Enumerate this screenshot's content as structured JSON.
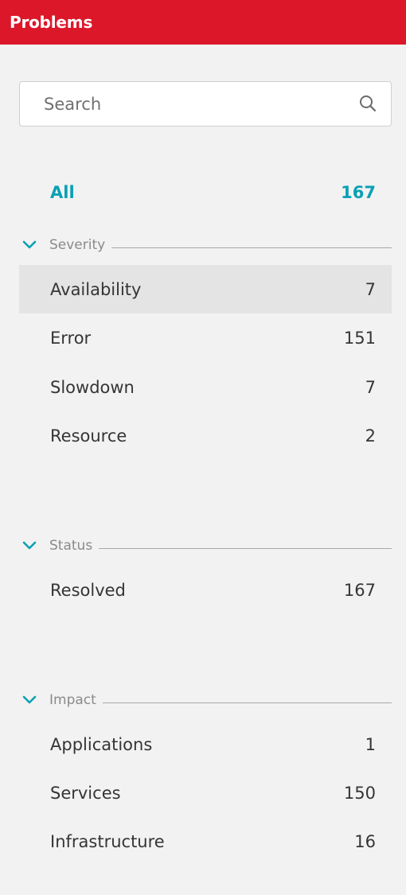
{
  "header": {
    "title": "Problems"
  },
  "search": {
    "placeholder": "Search"
  },
  "all": {
    "label": "All",
    "count": "167"
  },
  "severity": {
    "label": "Severity",
    "items": [
      {
        "label": "Availability",
        "count": "7"
      },
      {
        "label": "Error",
        "count": "151"
      },
      {
        "label": "Slowdown",
        "count": "7"
      },
      {
        "label": "Resource",
        "count": "2"
      }
    ]
  },
  "status": {
    "label": "Status",
    "items": [
      {
        "label": "Resolved",
        "count": "167"
      }
    ]
  },
  "impact": {
    "label": "Impact",
    "items": [
      {
        "label": "Applications",
        "count": "1"
      },
      {
        "label": "Services",
        "count": "150"
      },
      {
        "label": "Infrastructure",
        "count": "16"
      }
    ]
  },
  "colors": {
    "header_bg": "#dc172a",
    "accent": "#0aa0b4",
    "panel_bg": "#f2f2f2",
    "selected_row_bg": "#e4e4e4"
  },
  "icons": {
    "search": "search-icon",
    "section_toggle": "chevron-down-icon"
  }
}
